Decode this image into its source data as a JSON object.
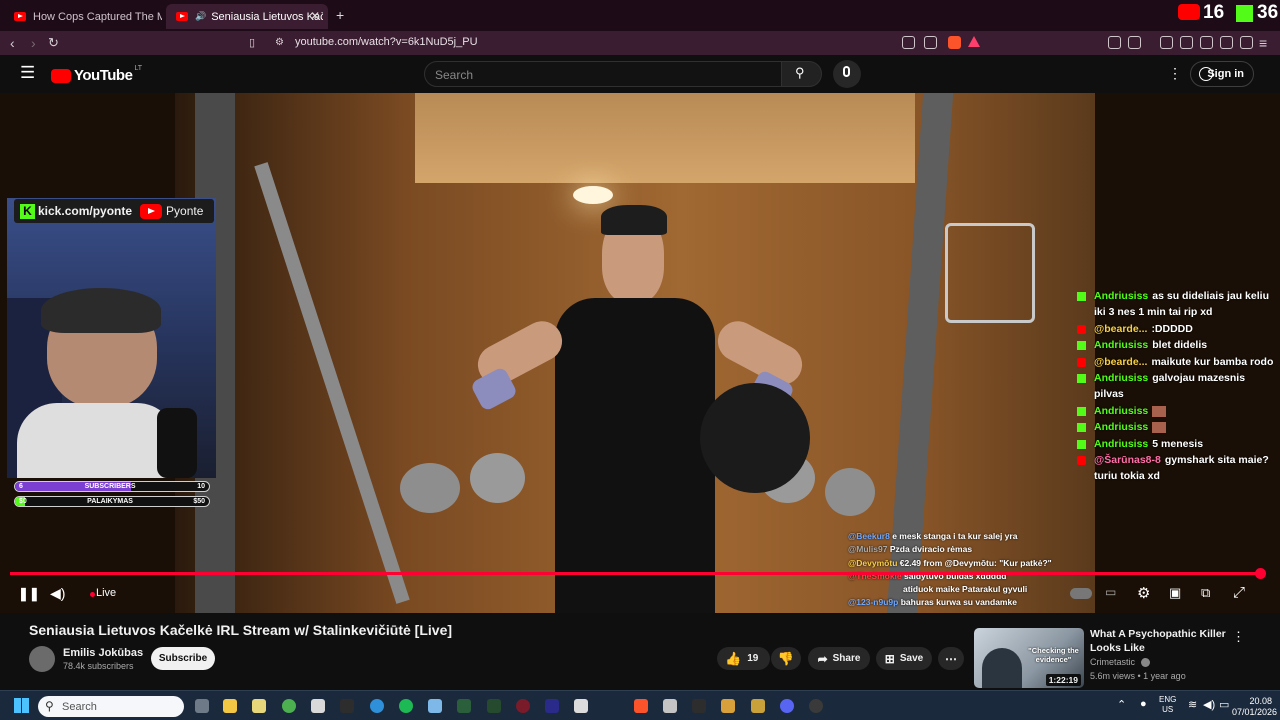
{
  "browser": {
    "tabs": [
      {
        "title": "How Cops Captured The Minnesota"
      },
      {
        "title": "Seniausia Lietuvos Kačelkė IR"
      }
    ],
    "new_tab_symbol": "+",
    "url": "youtube.com/watch?v=6k1NuD5j_PU",
    "corner_overlay": {
      "youtube_count": "16",
      "kick_count": "36"
    }
  },
  "youtube_header": {
    "logo_text": "YouTube",
    "country_code": "LT",
    "search_placeholder": "Search",
    "signin_label": "Sign in"
  },
  "video": {
    "overlay": {
      "kick_handle": "kick.com/pyonte",
      "youtube_handle": "Pyonte",
      "goals": [
        {
          "current": "6",
          "label": "SUBSCRIBERS",
          "target": "10",
          "progress": 0.6,
          "color": "#7b3fd1"
        },
        {
          "current": "$0",
          "label": "PALAIKYMAS",
          "target": "$50",
          "progress": 0.05,
          "color": "#53fc18"
        }
      ]
    },
    "chat": [
      {
        "platform": "kick",
        "name": "Andriusiss",
        "name_color": "#53fc18",
        "message": "as su dideliais jau keliu iki 3 nes 1 min tai rip xd"
      },
      {
        "platform": "youtube",
        "name": "@bearde...",
        "name_color": "#f7d046",
        "message": ":DDDDD"
      },
      {
        "platform": "kick",
        "name": "Andriusiss",
        "name_color": "#53fc18",
        "message": "blet didelis"
      },
      {
        "platform": "youtube",
        "name": "@bearde...",
        "name_color": "#f7d046",
        "message": "maikute kur bamba rodo"
      },
      {
        "platform": "kick",
        "name": "Andriusiss",
        "name_color": "#53fc18",
        "message": "galvojau mazesnis pilvas"
      },
      {
        "platform": "kick",
        "name": "Andriusiss",
        "name_color": "#53fc18",
        "message": ""
      },
      {
        "platform": "kick",
        "name": "Andriusiss",
        "name_color": "#53fc18",
        "message": ""
      },
      {
        "platform": "kick",
        "name": "Andriusiss",
        "name_color": "#53fc18",
        "message": "5 menesis"
      },
      {
        "platform": "youtube",
        "name": "@Šarūnas8-8",
        "name_color": "#ff6fa8",
        "message": "gymshark sita maie? turiu tokia xd"
      }
    ],
    "youtube_chat": [
      {
        "name": "@Beekur8",
        "name_color": "#6fa8ff",
        "message": "e mesk stanga i ta kur salej yra"
      },
      {
        "name": "@Mulis97",
        "name_color": "#aaa",
        "message": "Pzda dviracio rėmas"
      },
      {
        "name": "@Devymōtu",
        "name_color": "#f7d046",
        "message": "€2.49 from @Devymōtu: \"Kur patkė?\""
      },
      {
        "name": "@TheSmokie",
        "name_color": "#ff4040",
        "message": "saldytuvo buldas xddddd"
      },
      {
        "name": "",
        "name_color": "#fff",
        "message": "atiduok maike Patarakul gyvuli"
      },
      {
        "name": "@123-n9u9p",
        "name_color": "#6fa8ff",
        "message": "bahuras kurwa su vandamke"
      }
    ],
    "live_label": "Live",
    "progress": 1.0
  },
  "watch": {
    "title": "Seniausia Lietuvos Kačelkė IRL Stream w/ Stalinkevičiūtė [Live]",
    "channel": "Emilis Jokūbas",
    "subscribers": "78.4k subscribers",
    "subscribe_label": "Subscribe",
    "likes": "19",
    "share_label": "Share",
    "save_label": "Save"
  },
  "recommended": {
    "title": "What A Psychopathic Killer Looks Like",
    "channel": "Crimetastic",
    "meta": "5.6m views • 1 year ago",
    "duration": "1:22:19",
    "thumb_quote": "\"Checking the evidence\""
  },
  "taskbar": {
    "search_placeholder": "Search",
    "lang_top": "ENG",
    "lang_bottom": "US",
    "time": "20.08",
    "date": "07/01/2026"
  }
}
